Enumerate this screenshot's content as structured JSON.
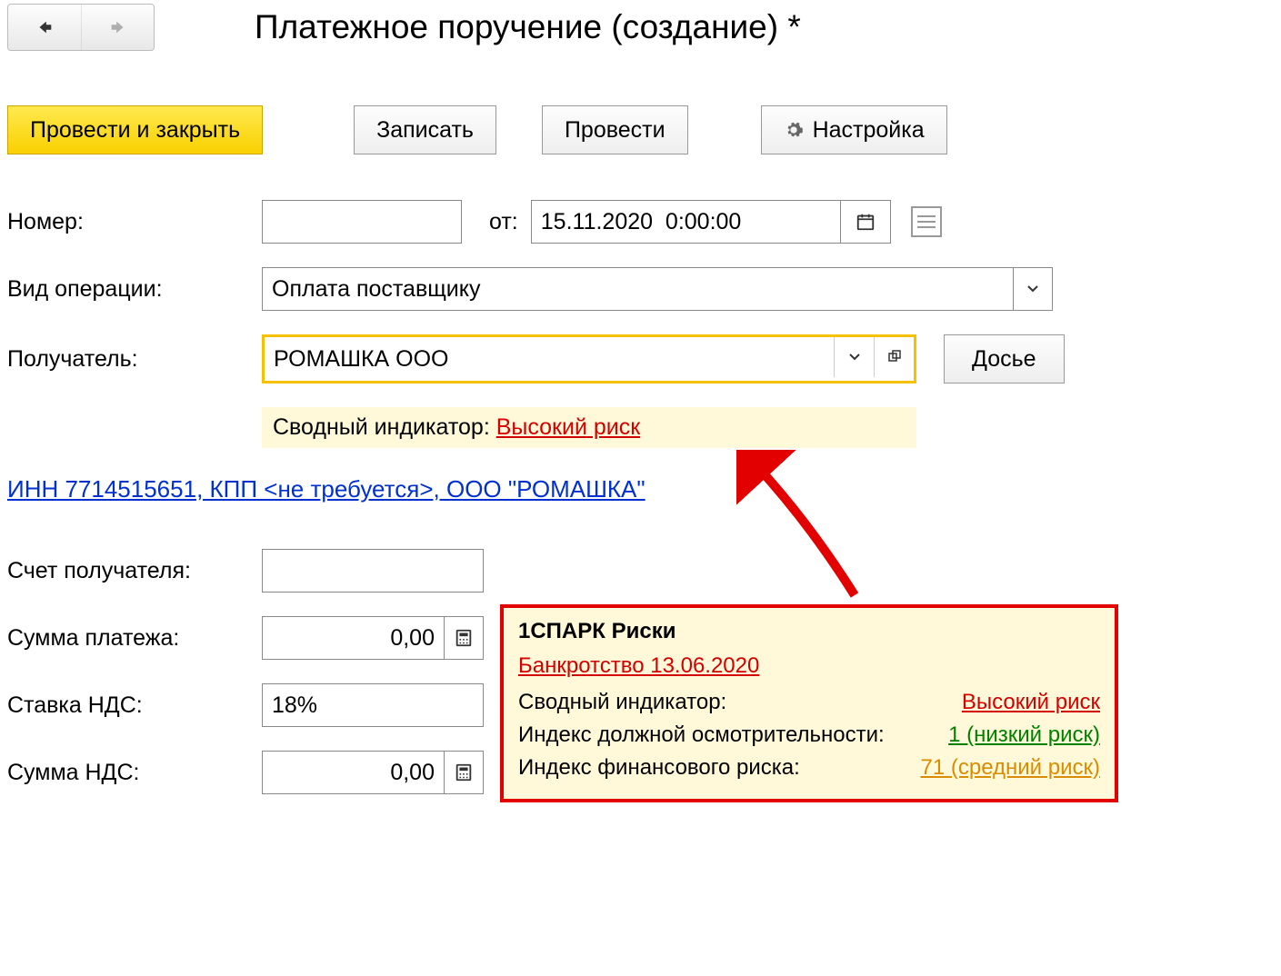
{
  "header": {
    "title": "Платежное поручение (создание) *"
  },
  "toolbar": {
    "post_close": "Провести и закрыть",
    "write": "Записать",
    "post": "Провести",
    "settings": "Настройка"
  },
  "labels": {
    "number": "Номер:",
    "from": "от:",
    "op_type": "Вид операции:",
    "recipient": "Получатель:",
    "dossier": "Досье",
    "indicator_label": "Сводный индикатор: ",
    "recipient_account": "Счет получателя:",
    "payment_amount": "Сумма платежа:",
    "vat_rate": "Ставка НДС:",
    "vat_amount": "Сумма НДС:"
  },
  "values": {
    "number": "",
    "date": "15.11.2020  0:00:00",
    "op_type": "Оплата поставщику",
    "recipient": "РОМАШКА ООО",
    "indicator_value": "Высокий риск",
    "inn_kpp_link": "ИНН 7714515651, КПП <не требуется>, ООО  \"РОМАШКА\"",
    "payment_amount": "0,00",
    "vat_rate": "18%",
    "vat_amount": "0,00"
  },
  "popup": {
    "title": "1СПАРК Риски",
    "bankruptcy": "Банкротство 13.06.2020",
    "rows": {
      "summary_label": "Сводный индикатор:",
      "summary_value": "Высокий риск",
      "due_label": "Индекс должной осмотрительности:",
      "due_value": "1 (низкий риск)",
      "fin_label": "Индекс финансового риска:",
      "fin_value": "71 (средний риск)"
    }
  }
}
